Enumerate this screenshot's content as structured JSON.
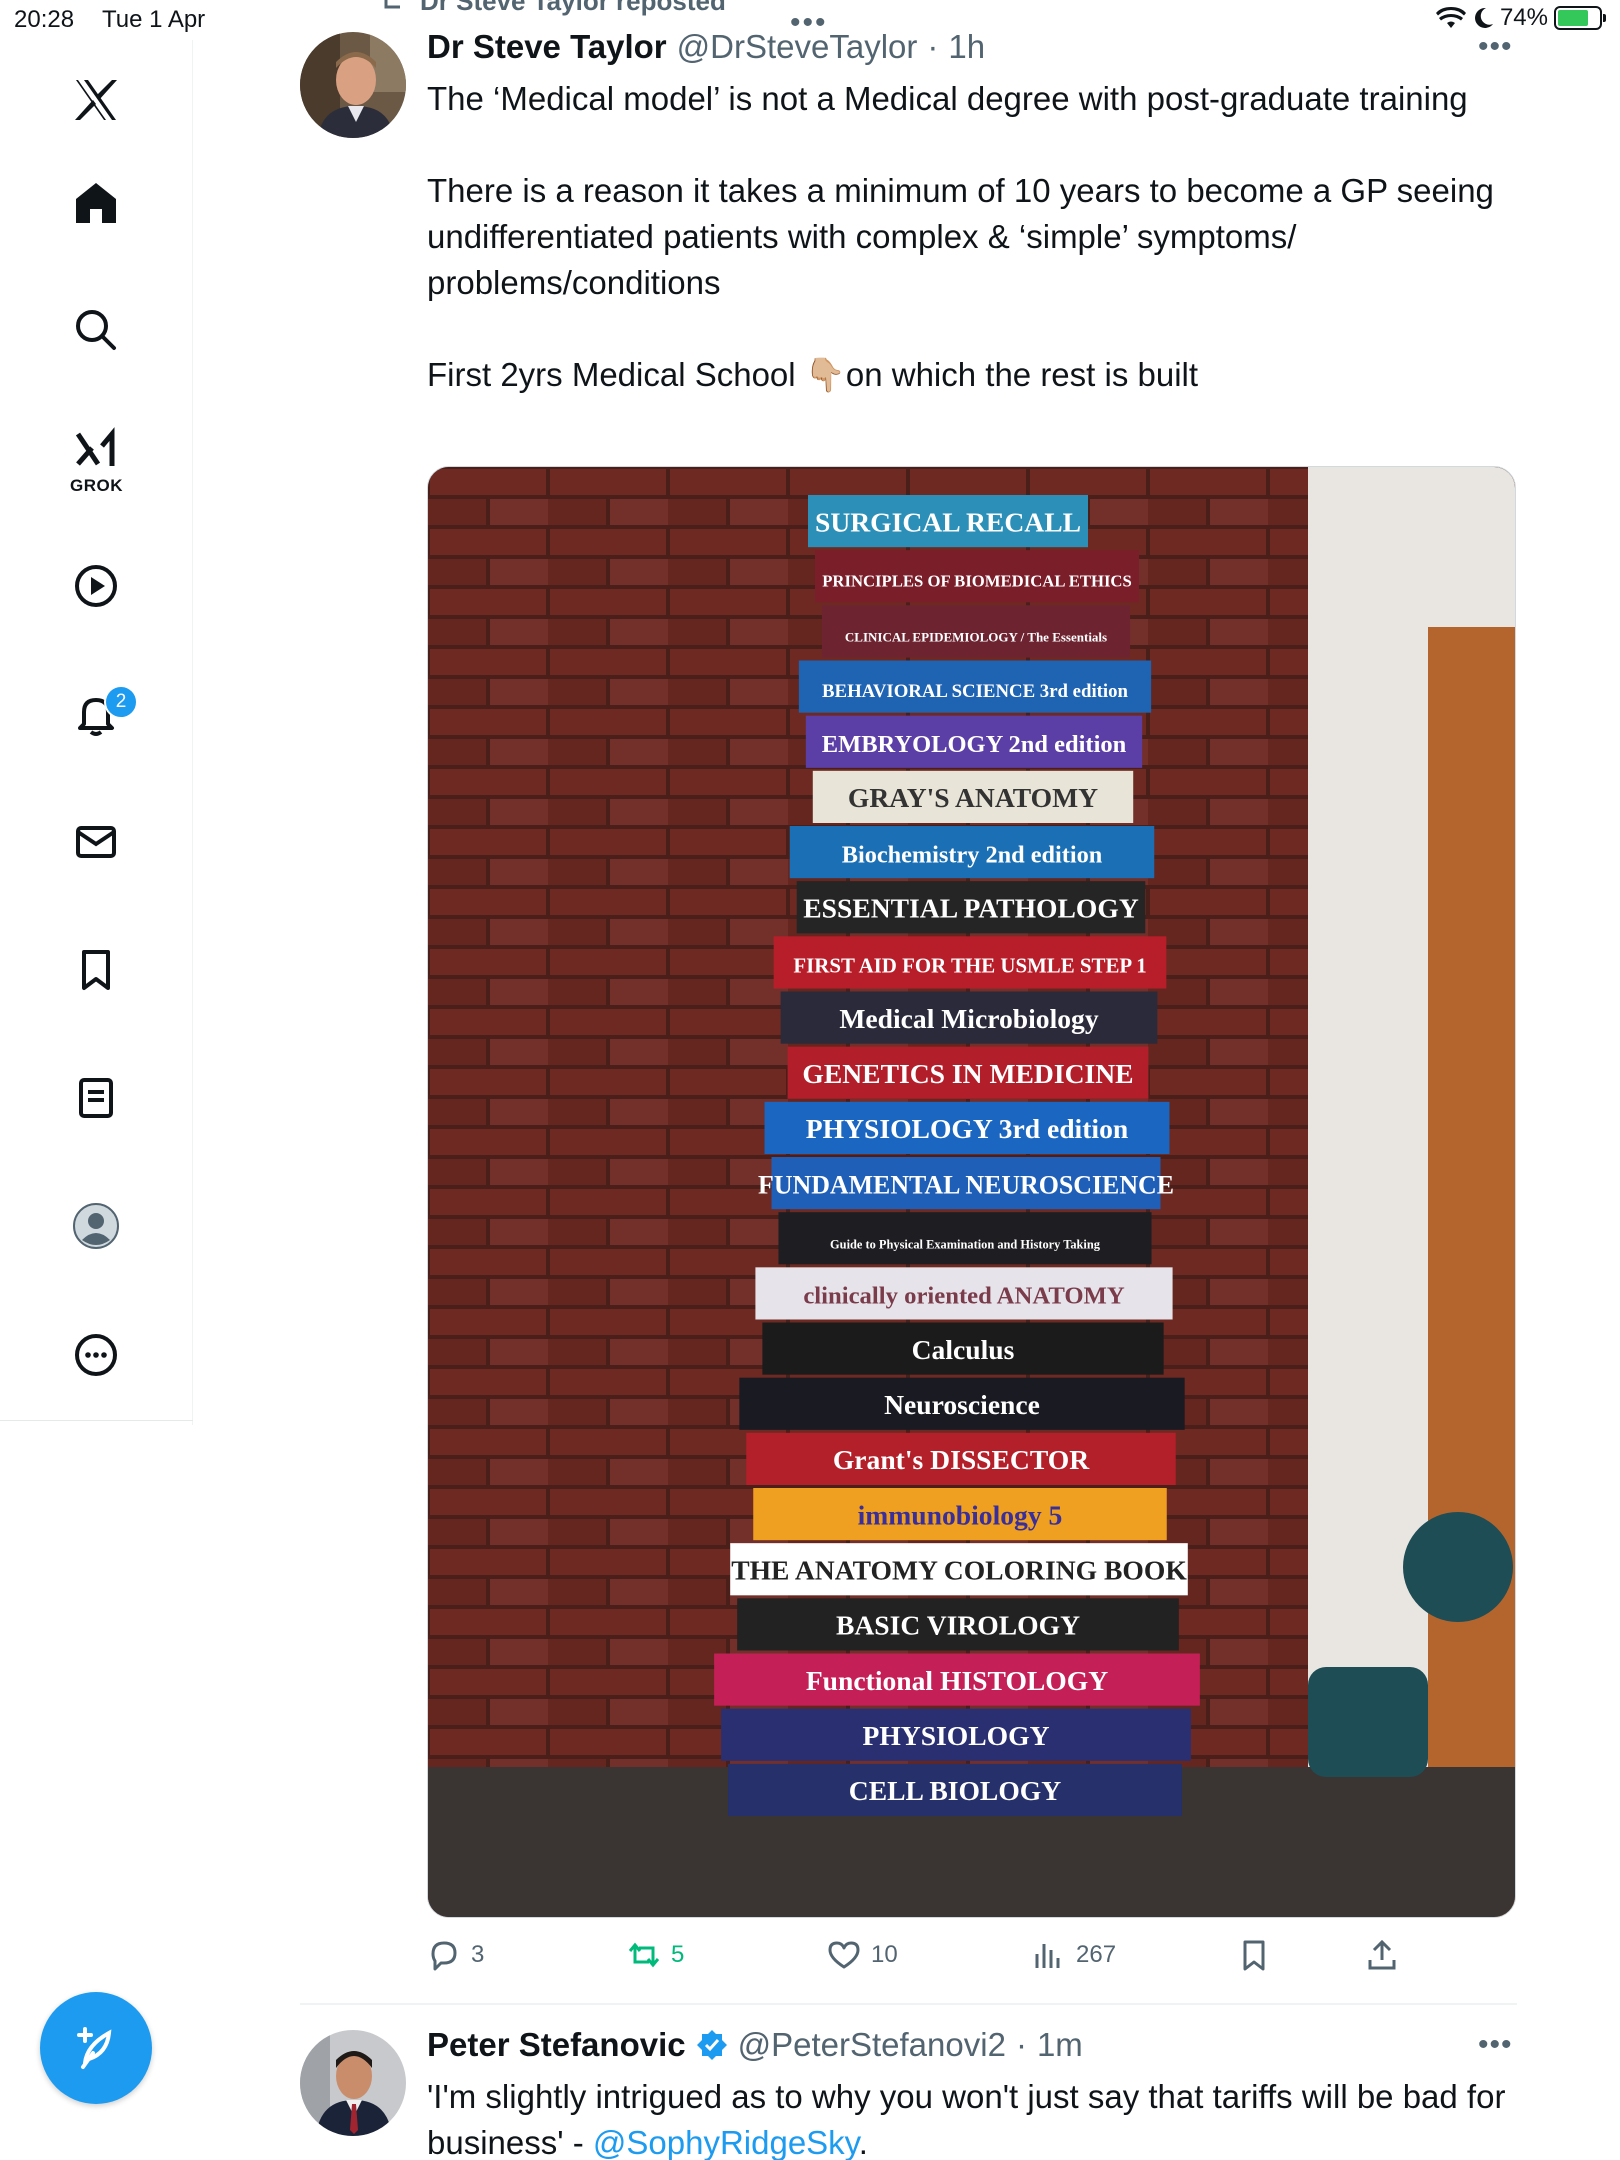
{
  "status_bar": {
    "time": "20:28",
    "date": "Tue 1 Apr",
    "battery": "74%"
  },
  "sidebar": {
    "items": [
      {
        "name": "logo",
        "icon": "x-logo-icon"
      },
      {
        "name": "home",
        "icon": "home-icon"
      },
      {
        "name": "search",
        "icon": "search-icon"
      },
      {
        "name": "grok",
        "icon": "grok-icon",
        "label": "GROK"
      },
      {
        "name": "video",
        "icon": "play-icon"
      },
      {
        "name": "notifications",
        "icon": "bell-icon",
        "badge": "2"
      },
      {
        "name": "messages",
        "icon": "mail-icon"
      },
      {
        "name": "bookmarks",
        "icon": "bookmark-icon"
      },
      {
        "name": "lists",
        "icon": "list-icon"
      },
      {
        "name": "profile",
        "icon": "profile-icon"
      },
      {
        "name": "more",
        "icon": "more-icon"
      }
    ],
    "compose_icon": "compose-icon"
  },
  "tweets": [
    {
      "repost_label": "Dr Steve Taylor reposted",
      "name": "Dr Steve Taylor",
      "handle": "@DrSteveTaylor",
      "time": "1h",
      "paragraphs": [
        "The ‘Medical model’ is not a  Medical degree with post-graduate training",
        "There is a reason it takes a minimum of 10 years to become a GP seeing undifferentiated patients with complex & ‘simple’ symptoms/ problems/conditions",
        "First 2yrs Medical School 👇🏼on which the rest is built"
      ],
      "stats": {
        "replies": "3",
        "reposts": "5",
        "likes": "10",
        "views": "267"
      },
      "book_spines": [
        "SURGICAL RECALL",
        "PRINCIPLES OF BIOMEDICAL ETHICS",
        "CLINICAL EPIDEMIOLOGY / The Essentials",
        "BEHAVIORAL SCIENCE 3rd edition",
        "EMBRYOLOGY 2nd edition",
        "GRAY'S ANATOMY",
        "Biochemistry 2nd edition",
        "ESSENTIAL PATHOLOGY",
        "FIRST AID FOR THE USMLE STEP 1",
        "Medical Microbiology",
        "GENETICS IN MEDICINE",
        "PHYSIOLOGY 3rd edition",
        "FUNDAMENTAL NEUROSCIENCE",
        "Guide to Physical Examination and History Taking",
        "clinically oriented ANATOMY",
        "Calculus",
        "Neuroscience",
        "Grant's DISSECTOR",
        "immunobiology 5",
        "THE ANATOMY COLORING BOOK",
        "BASIC VIROLOGY",
        "Functional HISTOLOGY",
        "PHYSIOLOGY",
        "CELL BIOLOGY"
      ]
    },
    {
      "name": "Peter Stefanovic",
      "handle": "@PeterStefanovi2",
      "time": "1m",
      "text_before": "'I'm slightly intrigued as to why you won't just say that tariffs will be bad for business' - ",
      "mention": "@SophyRidgeSky",
      "text_after": "."
    }
  ]
}
